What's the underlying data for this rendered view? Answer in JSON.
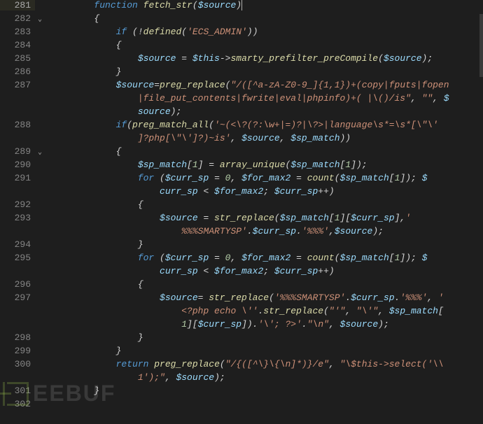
{
  "watermark": "EEBUF",
  "lines": [
    {
      "n": "281",
      "fold": "",
      "cur": true,
      "indent": "        ",
      "tokens": [
        {
          "c": "kw",
          "t": "function"
        },
        {
          "c": "pun",
          "t": " "
        },
        {
          "c": "fn",
          "t": "fetch_str"
        },
        {
          "c": "pun",
          "t": "("
        },
        {
          "c": "var",
          "t": "$source"
        },
        {
          "c": "pun",
          "t": ")"
        },
        {
          "c": "cursor",
          "t": ""
        }
      ]
    },
    {
      "n": "282",
      "fold": "⌄",
      "indent": "        ",
      "tokens": [
        {
          "c": "pun",
          "t": "{"
        }
      ]
    },
    {
      "n": "283",
      "fold": "",
      "indent": "            ",
      "tokens": [
        {
          "c": "kw",
          "t": "if"
        },
        {
          "c": "pun",
          "t": " (!"
        },
        {
          "c": "fn",
          "t": "defined"
        },
        {
          "c": "pun",
          "t": "("
        },
        {
          "c": "str",
          "t": "'ECS_ADMIN'"
        },
        {
          "c": "pun",
          "t": "))"
        }
      ]
    },
    {
      "n": "284",
      "fold": "",
      "indent": "            ",
      "tokens": [
        {
          "c": "pun",
          "t": "{"
        }
      ]
    },
    {
      "n": "285",
      "fold": "",
      "indent": "                ",
      "tokens": [
        {
          "c": "var",
          "t": "$source"
        },
        {
          "c": "pun",
          "t": " = "
        },
        {
          "c": "var",
          "t": "$this"
        },
        {
          "c": "pun",
          "t": "->"
        },
        {
          "c": "fn",
          "t": "smarty_prefilter_preCompile"
        },
        {
          "c": "pun",
          "t": "("
        },
        {
          "c": "var",
          "t": "$source"
        },
        {
          "c": "pun",
          "t": ");"
        }
      ]
    },
    {
      "n": "286",
      "fold": "",
      "indent": "            ",
      "tokens": [
        {
          "c": "pun",
          "t": "}"
        }
      ]
    },
    {
      "n": "287",
      "fold": "",
      "indent": "            ",
      "tokens": [
        {
          "c": "var",
          "t": "$source"
        },
        {
          "c": "pun",
          "t": "="
        },
        {
          "c": "fn",
          "t": "preg_replace"
        },
        {
          "c": "pun",
          "t": "("
        },
        {
          "c": "str",
          "t": "\"/([^a-zA-Z0-9_]{1,1})+(copy|fputs|fopen"
        }
      ]
    },
    {
      "n": "",
      "wrap": true,
      "indent": "                ",
      "tokens": [
        {
          "c": "str",
          "t": "|file_put_contents|fwrite|eval|phpinfo)+( |\\()/is\""
        },
        {
          "c": "pun",
          "t": ", "
        },
        {
          "c": "str",
          "t": "\"\""
        },
        {
          "c": "pun",
          "t": ", "
        },
        {
          "c": "var",
          "t": "$"
        }
      ]
    },
    {
      "n": "",
      "wrap": true,
      "indent": "                ",
      "tokens": [
        {
          "c": "var",
          "t": "source"
        },
        {
          "c": "pun",
          "t": ");"
        }
      ]
    },
    {
      "n": "288",
      "fold": "",
      "indent": "            ",
      "tokens": [
        {
          "c": "kw",
          "t": "if"
        },
        {
          "c": "pun",
          "t": "("
        },
        {
          "c": "fn",
          "t": "preg_match_all"
        },
        {
          "c": "pun",
          "t": "("
        },
        {
          "c": "str",
          "t": "'~(<\\?(?:\\w+|=)?|\\?>|language\\s*=\\s*[\\\"\\'"
        }
      ]
    },
    {
      "n": "",
      "wrap": true,
      "indent": "                ",
      "tokens": [
        {
          "c": "str",
          "t": "]?php[\\\"\\']?)~is'"
        },
        {
          "c": "pun",
          "t": ", "
        },
        {
          "c": "var",
          "t": "$source"
        },
        {
          "c": "pun",
          "t": ", "
        },
        {
          "c": "var",
          "t": "$sp_match"
        },
        {
          "c": "pun",
          "t": "))"
        }
      ]
    },
    {
      "n": "289",
      "fold": "⌄",
      "indent": "            ",
      "tokens": [
        {
          "c": "pun",
          "t": "{"
        }
      ]
    },
    {
      "n": "290",
      "fold": "",
      "indent": "                ",
      "tokens": [
        {
          "c": "var",
          "t": "$sp_match"
        },
        {
          "c": "pun",
          "t": "["
        },
        {
          "c": "num",
          "t": "1"
        },
        {
          "c": "pun",
          "t": "] = "
        },
        {
          "c": "fn",
          "t": "array_unique"
        },
        {
          "c": "pun",
          "t": "("
        },
        {
          "c": "var",
          "t": "$sp_match"
        },
        {
          "c": "pun",
          "t": "["
        },
        {
          "c": "num",
          "t": "1"
        },
        {
          "c": "pun",
          "t": "]);"
        }
      ]
    },
    {
      "n": "291",
      "fold": "",
      "indent": "                ",
      "tokens": [
        {
          "c": "kw",
          "t": "for"
        },
        {
          "c": "pun",
          "t": " ("
        },
        {
          "c": "var",
          "t": "$curr_sp"
        },
        {
          "c": "pun",
          "t": " = "
        },
        {
          "c": "num",
          "t": "0"
        },
        {
          "c": "pun",
          "t": ", "
        },
        {
          "c": "var",
          "t": "$for_max2"
        },
        {
          "c": "pun",
          "t": " = "
        },
        {
          "c": "fn",
          "t": "count"
        },
        {
          "c": "pun",
          "t": "("
        },
        {
          "c": "var",
          "t": "$sp_match"
        },
        {
          "c": "pun",
          "t": "["
        },
        {
          "c": "num",
          "t": "1"
        },
        {
          "c": "pun",
          "t": "]); "
        },
        {
          "c": "var",
          "t": "$"
        }
      ]
    },
    {
      "n": "",
      "wrap": true,
      "indent": "                    ",
      "tokens": [
        {
          "c": "var",
          "t": "curr_sp"
        },
        {
          "c": "pun",
          "t": " < "
        },
        {
          "c": "var",
          "t": "$for_max2"
        },
        {
          "c": "pun",
          "t": "; "
        },
        {
          "c": "var",
          "t": "$curr_sp"
        },
        {
          "c": "pun",
          "t": "++)"
        }
      ]
    },
    {
      "n": "292",
      "fold": "",
      "indent": "                ",
      "tokens": [
        {
          "c": "pun",
          "t": "{"
        }
      ]
    },
    {
      "n": "293",
      "fold": "",
      "indent": "                    ",
      "tokens": [
        {
          "c": "var",
          "t": "$source"
        },
        {
          "c": "pun",
          "t": " = "
        },
        {
          "c": "fn",
          "t": "str_replace"
        },
        {
          "c": "pun",
          "t": "("
        },
        {
          "c": "var",
          "t": "$sp_match"
        },
        {
          "c": "pun",
          "t": "["
        },
        {
          "c": "num",
          "t": "1"
        },
        {
          "c": "pun",
          "t": "]["
        },
        {
          "c": "var",
          "t": "$curr_sp"
        },
        {
          "c": "pun",
          "t": "],"
        },
        {
          "c": "str",
          "t": "'"
        }
      ]
    },
    {
      "n": "",
      "wrap": true,
      "indent": "                        ",
      "tokens": [
        {
          "c": "str",
          "t": "%%%SMARTYSP'"
        },
        {
          "c": "pun",
          "t": "."
        },
        {
          "c": "var",
          "t": "$curr_sp"
        },
        {
          "c": "pun",
          "t": "."
        },
        {
          "c": "str",
          "t": "'%%%'"
        },
        {
          "c": "pun",
          "t": ","
        },
        {
          "c": "var",
          "t": "$source"
        },
        {
          "c": "pun",
          "t": ");"
        }
      ]
    },
    {
      "n": "294",
      "fold": "",
      "indent": "                ",
      "tokens": [
        {
          "c": "pun",
          "t": "}"
        }
      ]
    },
    {
      "n": "295",
      "fold": "",
      "indent": "                ",
      "tokens": [
        {
          "c": "kw",
          "t": "for"
        },
        {
          "c": "pun",
          "t": " ("
        },
        {
          "c": "var",
          "t": "$curr_sp"
        },
        {
          "c": "pun",
          "t": " = "
        },
        {
          "c": "num",
          "t": "0"
        },
        {
          "c": "pun",
          "t": ", "
        },
        {
          "c": "var",
          "t": "$for_max2"
        },
        {
          "c": "pun",
          "t": " = "
        },
        {
          "c": "fn",
          "t": "count"
        },
        {
          "c": "pun",
          "t": "("
        },
        {
          "c": "var",
          "t": "$sp_match"
        },
        {
          "c": "pun",
          "t": "["
        },
        {
          "c": "num",
          "t": "1"
        },
        {
          "c": "pun",
          "t": "]); "
        },
        {
          "c": "var",
          "t": "$"
        }
      ]
    },
    {
      "n": "",
      "wrap": true,
      "indent": "                    ",
      "tokens": [
        {
          "c": "var",
          "t": "curr_sp"
        },
        {
          "c": "pun",
          "t": " < "
        },
        {
          "c": "var",
          "t": "$for_max2"
        },
        {
          "c": "pun",
          "t": "; "
        },
        {
          "c": "var",
          "t": "$curr_sp"
        },
        {
          "c": "pun",
          "t": "++)"
        }
      ]
    },
    {
      "n": "296",
      "fold": "",
      "indent": "                ",
      "tokens": [
        {
          "c": "pun",
          "t": "{"
        }
      ]
    },
    {
      "n": "297",
      "fold": "",
      "indent": "                    ",
      "tokens": [
        {
          "c": "var",
          "t": "$source"
        },
        {
          "c": "pun",
          "t": "= "
        },
        {
          "c": "fn",
          "t": "str_replace"
        },
        {
          "c": "pun",
          "t": "("
        },
        {
          "c": "str",
          "t": "'%%%SMARTYSP'"
        },
        {
          "c": "pun",
          "t": "."
        },
        {
          "c": "var",
          "t": "$curr_sp"
        },
        {
          "c": "pun",
          "t": "."
        },
        {
          "c": "str",
          "t": "'%%%'"
        },
        {
          "c": "pun",
          "t": ", "
        },
        {
          "c": "str",
          "t": "'"
        }
      ]
    },
    {
      "n": "",
      "wrap": true,
      "indent": "                        ",
      "tokens": [
        {
          "c": "str",
          "t": "<?php echo \\''"
        },
        {
          "c": "pun",
          "t": "."
        },
        {
          "c": "fn",
          "t": "str_replace"
        },
        {
          "c": "pun",
          "t": "("
        },
        {
          "c": "str",
          "t": "\"'\""
        },
        {
          "c": "pun",
          "t": ", "
        },
        {
          "c": "str",
          "t": "\"\\'\""
        },
        {
          "c": "pun",
          "t": ", "
        },
        {
          "c": "var",
          "t": "$sp_match"
        },
        {
          "c": "pun",
          "t": "["
        }
      ]
    },
    {
      "n": "",
      "wrap": true,
      "indent": "                        ",
      "tokens": [
        {
          "c": "num",
          "t": "1"
        },
        {
          "c": "pun",
          "t": "]["
        },
        {
          "c": "var",
          "t": "$curr_sp"
        },
        {
          "c": "pun",
          "t": "])."
        },
        {
          "c": "str",
          "t": "'\\'; ?>'"
        },
        {
          "c": "pun",
          "t": "."
        },
        {
          "c": "str",
          "t": "\"\\n\""
        },
        {
          "c": "pun",
          "t": ", "
        },
        {
          "c": "var",
          "t": "$source"
        },
        {
          "c": "pun",
          "t": ");"
        }
      ]
    },
    {
      "n": "298",
      "fold": "",
      "indent": "                ",
      "tokens": [
        {
          "c": "pun",
          "t": "}"
        }
      ]
    },
    {
      "n": "299",
      "fold": "",
      "indent": "            ",
      "tokens": [
        {
          "c": "pun",
          "t": "}"
        }
      ]
    },
    {
      "n": "300",
      "fold": "",
      "indent": "            ",
      "tokens": [
        {
          "c": "kw",
          "t": "return"
        },
        {
          "c": "pun",
          "t": " "
        },
        {
          "c": "fn",
          "t": "preg_replace"
        },
        {
          "c": "pun",
          "t": "("
        },
        {
          "c": "str",
          "t": "\"/{([^\\}\\{\\n]*)}/e\""
        },
        {
          "c": "pun",
          "t": ", "
        },
        {
          "c": "str",
          "t": "\"\\$this->select('\\\\"
        }
      ]
    },
    {
      "n": "",
      "wrap": true,
      "indent": "                ",
      "tokens": [
        {
          "c": "str",
          "t": "1');\""
        },
        {
          "c": "pun",
          "t": ", "
        },
        {
          "c": "var",
          "t": "$source"
        },
        {
          "c": "pun",
          "t": ");"
        }
      ]
    },
    {
      "n": "301",
      "fold": "",
      "indent": "        ",
      "tokens": [
        {
          "c": "pun",
          "t": "}"
        }
      ]
    },
    {
      "n": "302",
      "fold": "",
      "indent": "",
      "tokens": []
    }
  ]
}
